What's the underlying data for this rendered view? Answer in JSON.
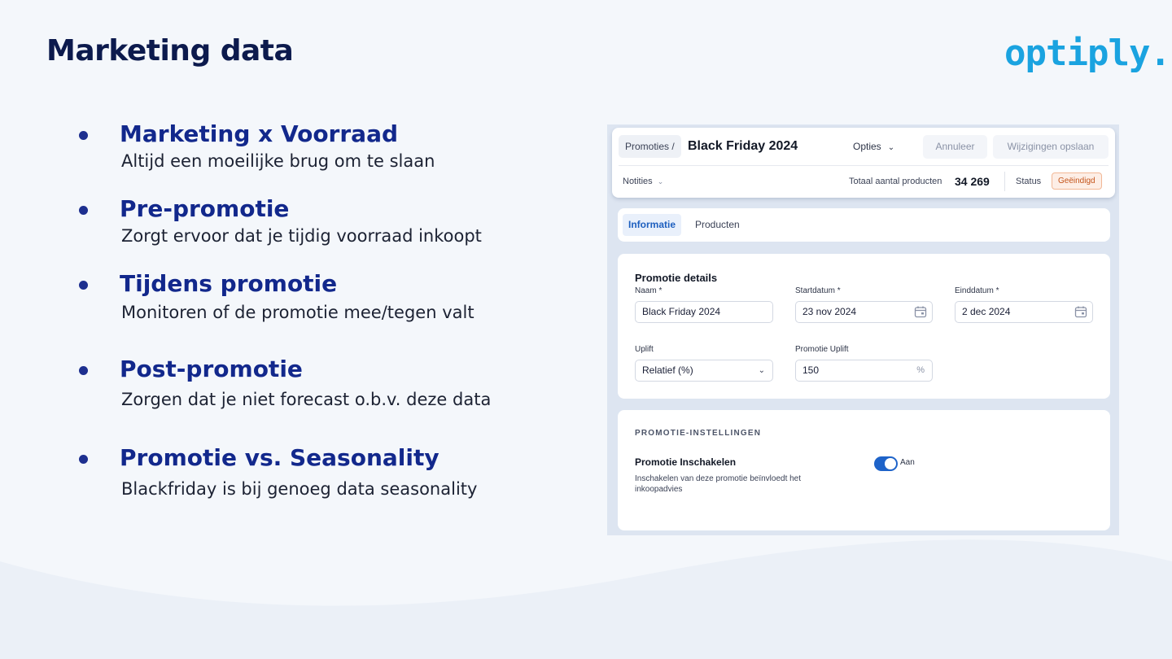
{
  "slide": {
    "title": "Marketing data",
    "logo": "optiply."
  },
  "bullets": [
    {
      "title": "Marketing x Voorraad",
      "sub": "Altijd een moeilijke brug om te slaan"
    },
    {
      "title": "Pre-promotie",
      "sub": "Zorgt ervoor dat je tijdig voorraad inkoopt"
    },
    {
      "title": "Tijdens promotie",
      "sub": "Monitoren of de promotie mee/tegen valt"
    },
    {
      "title": "Post-promotie",
      "sub": "Zorgen dat je niet forecast o.b.v. deze data"
    },
    {
      "title": "Promotie vs. Seasonality",
      "sub": "Blackfriday is bij genoeg data seasonality"
    }
  ],
  "app": {
    "header": {
      "breadcrumb": "Promoties /",
      "title": "Black Friday 2024",
      "options_label": "Opties",
      "cancel_label": "Annuleer",
      "save_label": "Wijzigingen opslaan",
      "notes_label": "Notities",
      "total_products_label": "Totaal aantal producten",
      "total_products_value": "34 269",
      "status_label": "Status",
      "status_value": "Geëindigd"
    },
    "tabs": [
      {
        "label": "Informatie",
        "active": true
      },
      {
        "label": "Producten",
        "active": false
      }
    ],
    "details": {
      "section_title": "Promotie details",
      "name_label": "Naam *",
      "name_value": "Black Friday 2024",
      "start_label": "Startdatum *",
      "start_value": "23 nov 2024",
      "end_label": "Einddatum *",
      "end_value": "2 dec 2024",
      "uplift_label": "Uplift",
      "uplift_value": "Relatief (%)",
      "promo_uplift_label": "Promotie Uplift",
      "promo_uplift_value": "150",
      "promo_uplift_suffix": "%"
    },
    "settings": {
      "section_title": "PROMOTIE-INSTELLINGEN",
      "toggle_name": "Promotie Inschakelen",
      "toggle_desc": "Inschakelen van deze promotie beïnvloedt het inkoopadvies",
      "toggle_state_label": "Aan",
      "toggle_on": true
    }
  },
  "colors": {
    "accent": "#12288c",
    "logo": "#1aa3e0",
    "toggle": "#1e63c9",
    "status_badge": "#c4541a"
  }
}
